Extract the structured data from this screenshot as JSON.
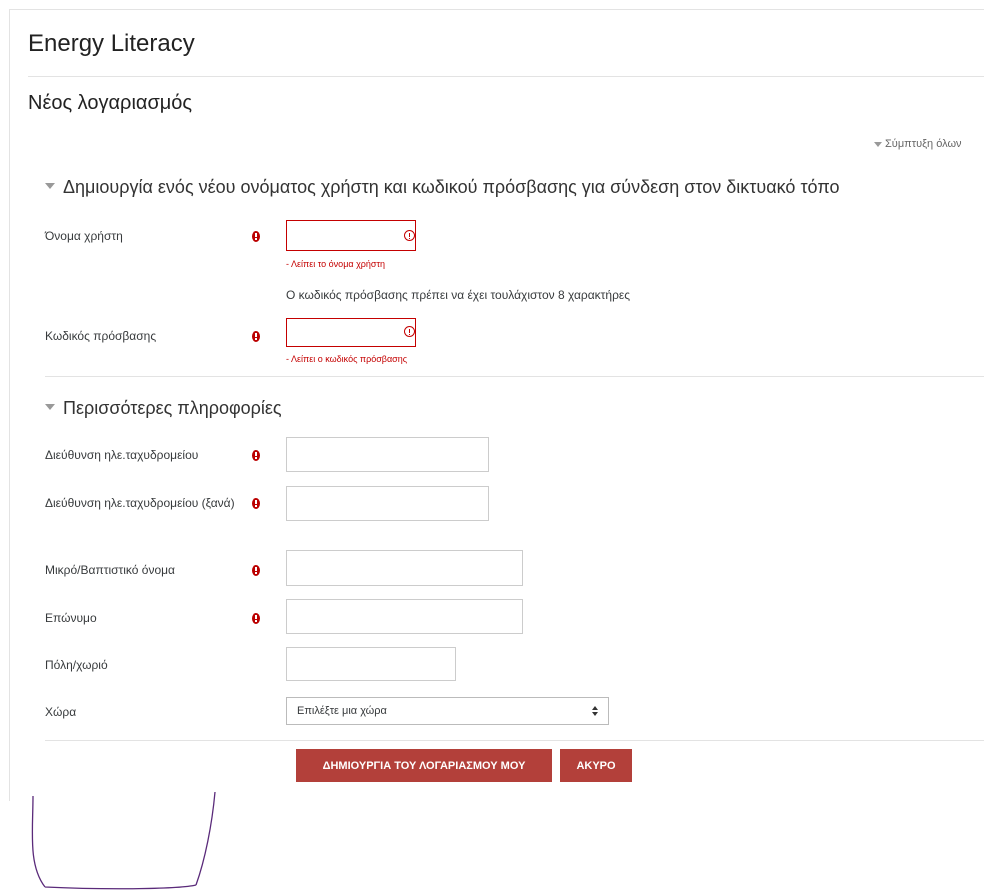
{
  "site": {
    "title": "Energy Literacy"
  },
  "page": {
    "title": "Νέος λογαριασμός",
    "collapse_all": "Σύμπτυξη όλων"
  },
  "section1": {
    "legend": "Δημιουργία ενός νέου ονόματος χρήστη και κωδικού πρόσβασης για σύνδεση στον δικτυακό τόπο",
    "username": {
      "label": "Όνομα χρήστη",
      "value": "",
      "error": "- Λείπει το όνομα χρήστη"
    },
    "password_hint": "Ο κωδικός πρόσβασης πρέπει να έχει τουλάχιστον 8 χαρακτήρες",
    "password": {
      "label": "Κωδικός πρόσβασης",
      "value": "",
      "error": "- Λείπει ο κωδικός πρόσβασης"
    }
  },
  "section2": {
    "legend": "Περισσότερες πληροφορίες",
    "email": {
      "label": "Διεύθυνση ηλε.ταχυδρομείου",
      "value": ""
    },
    "email2": {
      "label": "Διεύθυνση ηλε.ταχυδρομείου (ξανά)",
      "value": ""
    },
    "firstname": {
      "label": "Μικρό/Βαπτιστικό όνομα",
      "value": ""
    },
    "lastname": {
      "label": "Επώνυμο",
      "value": ""
    },
    "city": {
      "label": "Πόλη/χωριό",
      "value": ""
    },
    "country": {
      "label": "Χώρα",
      "selected": "Επιλέξτε μια χώρα"
    }
  },
  "actions": {
    "create": "ΔΗΜΙΟΥΡΓΙΑ ΤΟΥ ΛΟΓΑΡΙΑΣΜΟΥ ΜΟΥ",
    "cancel": "ΑΚΥΡΟ"
  },
  "colors": {
    "accent": "#b3403a",
    "error": "#c40000",
    "required": "#b00000"
  },
  "icons": {
    "required": "exclamation-circle-icon",
    "invalid": "warning-circle-icon",
    "collapse": "caret-down-icon",
    "select": "sort-arrows-icon"
  }
}
